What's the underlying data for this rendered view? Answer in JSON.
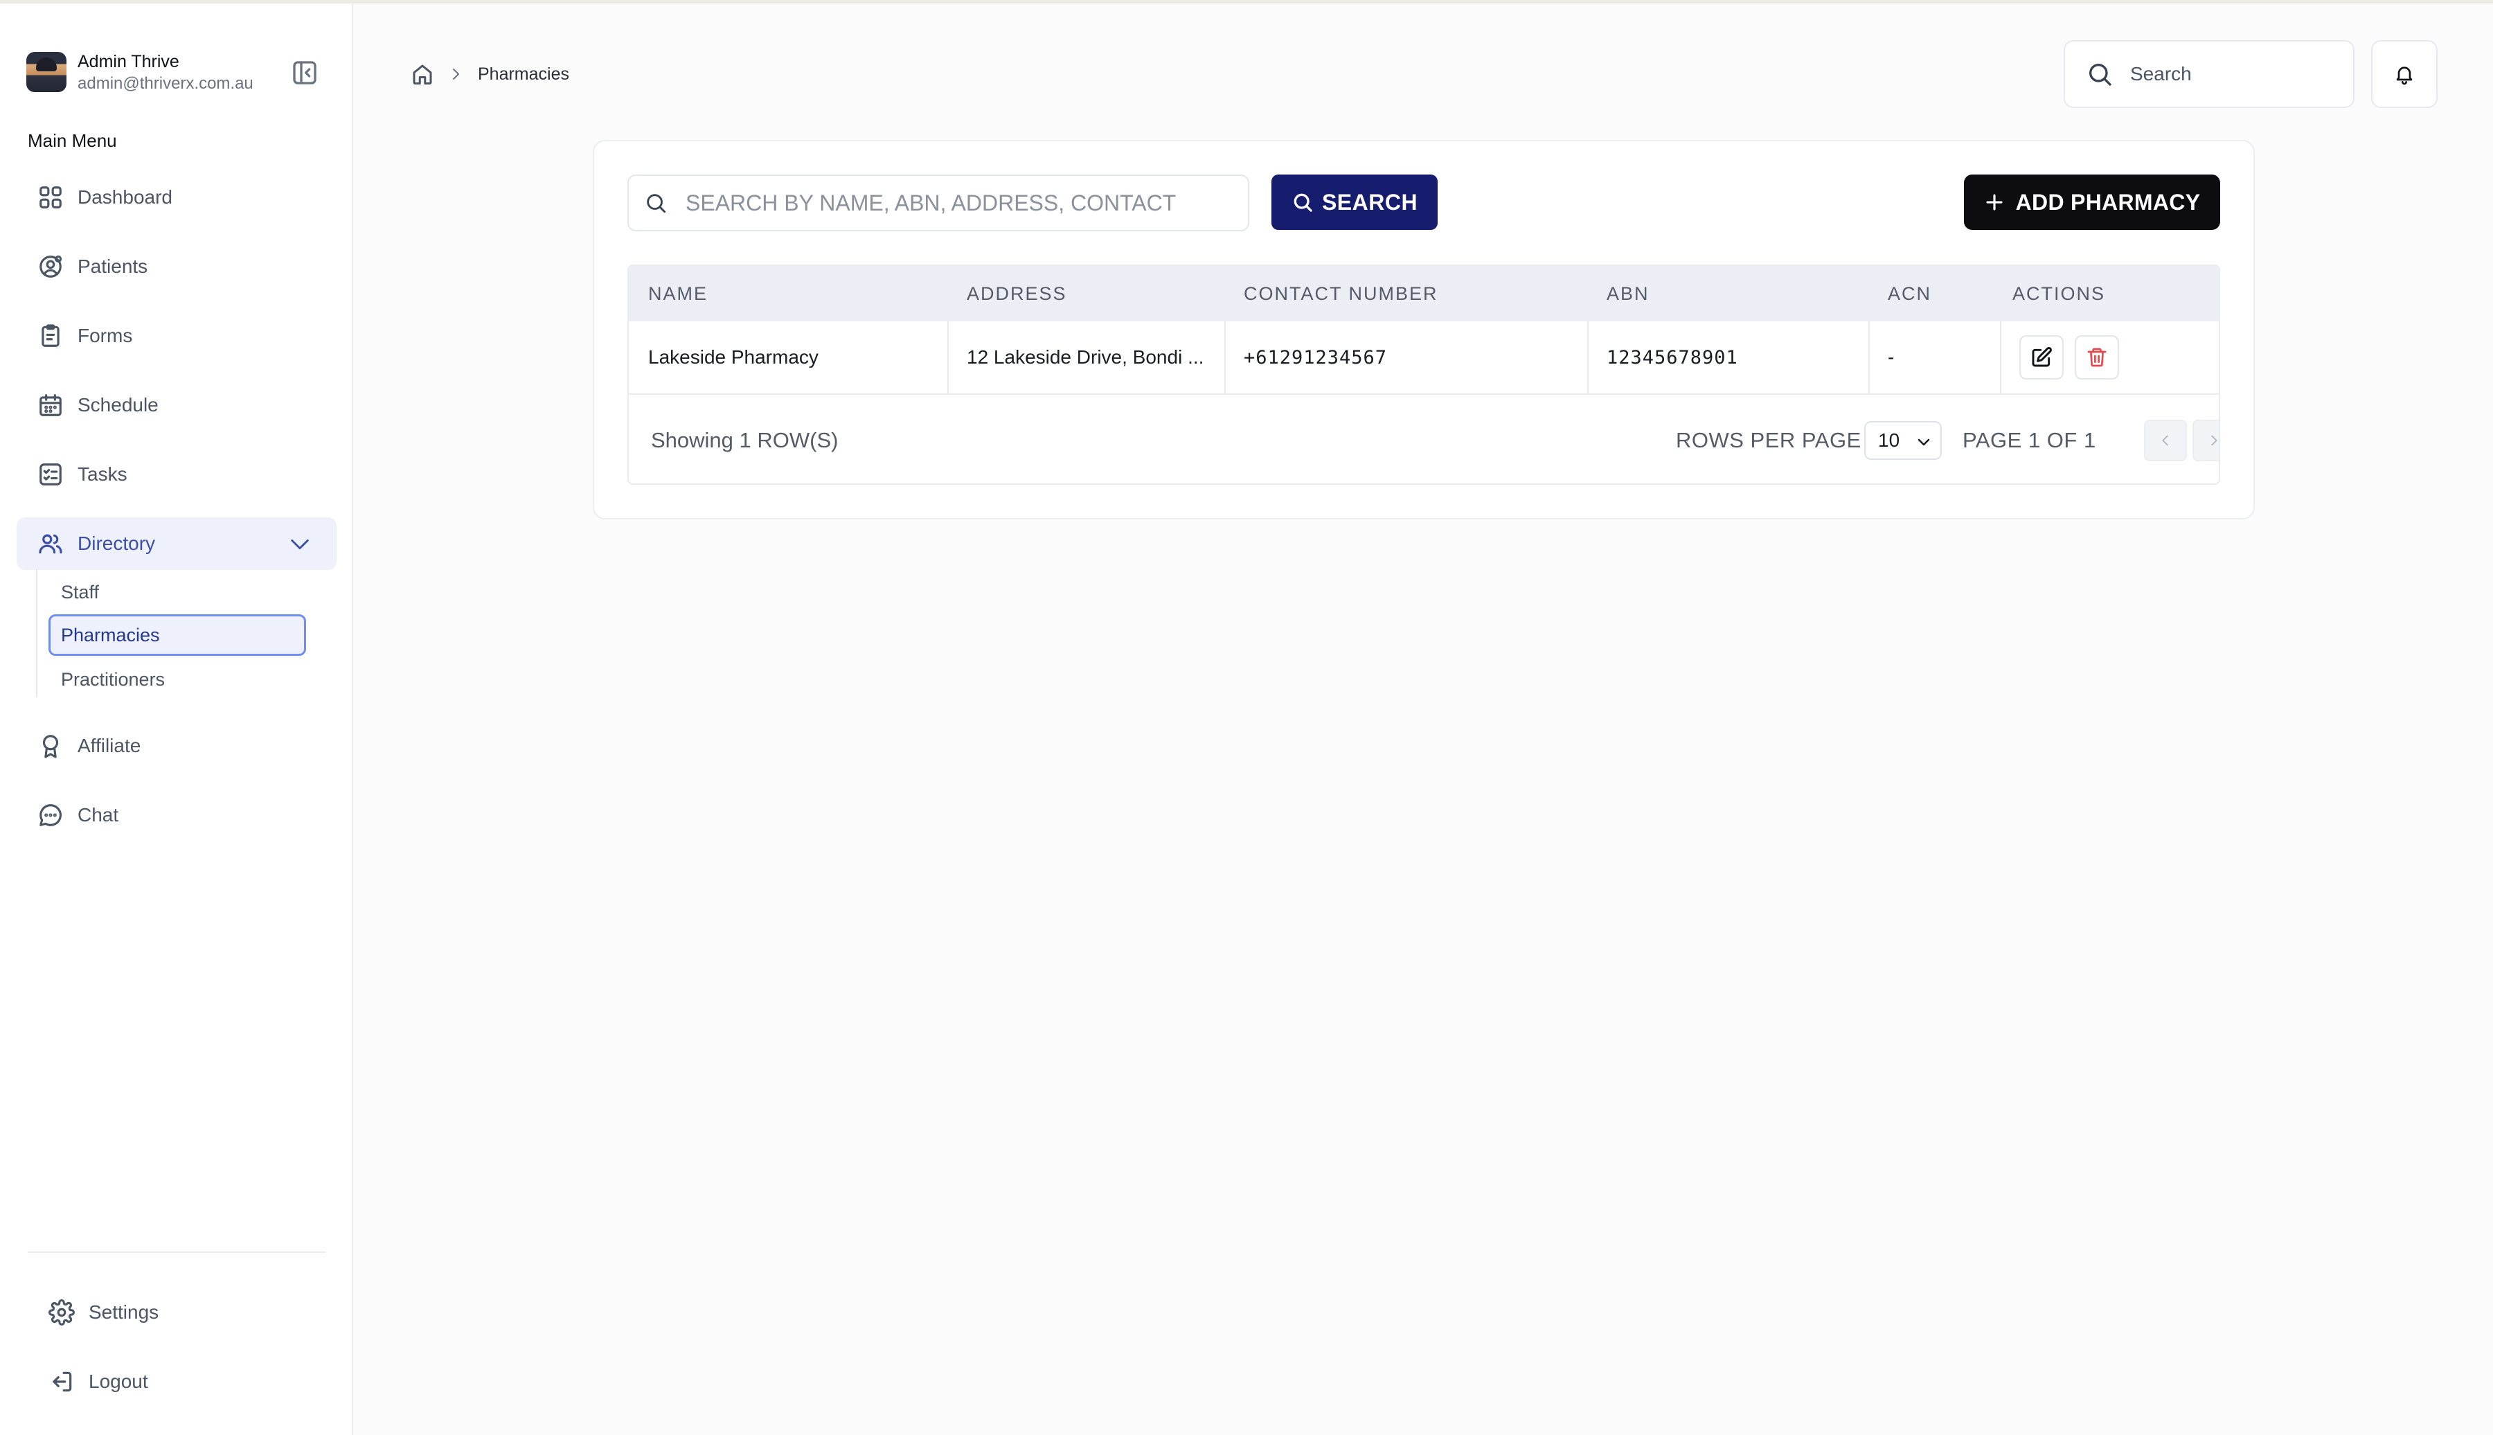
{
  "user": {
    "name": "Admin Thrive",
    "email": "admin@thriverx.com.au"
  },
  "sidebar": {
    "heading": "Main Menu",
    "items": [
      {
        "label": "Dashboard",
        "icon": "dashboard-grid-icon"
      },
      {
        "label": "Patients",
        "icon": "user-circle-icon"
      },
      {
        "label": "Forms",
        "icon": "clipboard-icon"
      },
      {
        "label": "Schedule",
        "icon": "calendar-icon"
      },
      {
        "label": "Tasks",
        "icon": "checklist-icon"
      },
      {
        "label": "Directory",
        "icon": "users-icon",
        "expanded": true
      },
      {
        "label": "Affiliate",
        "icon": "award-icon"
      },
      {
        "label": "Chat",
        "icon": "chat-bubble-icon"
      }
    ],
    "directory_children": [
      "Staff",
      "Pharmacies",
      "Practitioners"
    ],
    "active_child": "Pharmacies",
    "footer": [
      {
        "label": "Settings",
        "icon": "gear-icon"
      },
      {
        "label": "Logout",
        "icon": "logout-icon"
      }
    ]
  },
  "breadcrumb": {
    "current": "Pharmacies"
  },
  "topbar": {
    "search_placeholder": "Search"
  },
  "toolbar": {
    "search_placeholder": "SEARCH BY NAME, ABN, ADDRESS, CONTACT",
    "search_button": "SEARCH",
    "add_button": "ADD PHARMACY"
  },
  "table": {
    "columns": [
      "NAME",
      "ADDRESS",
      "CONTACT NUMBER",
      "ABN",
      "ACN",
      "ACTIONS"
    ],
    "rows": [
      {
        "name": "Lakeside Pharmacy",
        "address": "12 Lakeside Drive, Bondi ...",
        "contact": "+61291234567",
        "abn": "12345678901",
        "acn": "-"
      }
    ]
  },
  "pagination": {
    "showing": "Showing 1 ROW(S)",
    "rows_per_page_label": "ROWS PER PAGE",
    "rows_per_page": "10",
    "page_info": "PAGE 1 OF 1"
  },
  "colors": {
    "primary_navy": "#161c6e",
    "active_blue": "#3b4fa8",
    "delete_red": "#e5484d"
  }
}
